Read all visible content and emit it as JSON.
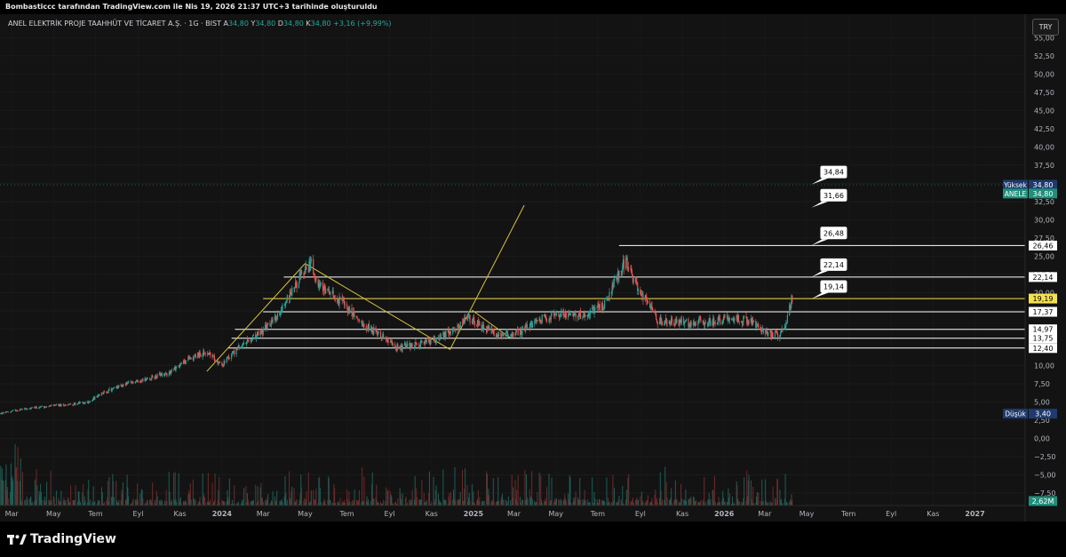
{
  "header": {
    "title": "Bombasticcc tarafından TradingView.com ile Nis 19, 2026 21:37 UTC+3 tarihinde oluşturuldu"
  },
  "legend": {
    "symbol": "ANEL ELEKTRİK PROJE TAAHHÜT VE TİCARET A.Ş. · 1G · BIST",
    "o_label": "A",
    "o_value": "34,80",
    "h_label": "Y",
    "h_value": "34,80",
    "l_label": "D",
    "l_value": "34,80",
    "c_label": "K",
    "c_value": "34,80",
    "change": "+3,16 (+9,99%)"
  },
  "currency": "TRY",
  "brand": "TradingView",
  "colors": {
    "up": "#26a69a",
    "down": "#ef5350",
    "trendline": "#d8c33a",
    "level": "#ffffff",
    "highlight": "#f5e050",
    "high_badge": "#1e3a6e",
    "price_badge": "#1f8f7a"
  },
  "chart_data": {
    "type": "candlestick",
    "ylim": [
      -9.2,
      58.2
    ],
    "xlim": [
      "2023-02-12",
      "2027-03-15"
    ],
    "y_ticks": [
      "55,00",
      "52,50",
      "50,00",
      "47,50",
      "45,00",
      "42,50",
      "40,00",
      "37,50",
      "35,00",
      "32,50",
      "30,00",
      "27,50",
      "25,00",
      "22,50",
      "20,00",
      "17,50",
      "15,00",
      "12,50",
      "10,00",
      "7,50",
      "5,00",
      "2,50",
      "0,00",
      "−2,50",
      "−5,00",
      "−7,50"
    ],
    "x_ticks": [
      {
        "label": "Mar",
        "date": "2023-03-01"
      },
      {
        "label": "May",
        "date": "2023-05-01"
      },
      {
        "label": "Tem",
        "date": "2023-07-01"
      },
      {
        "label": "Eyl",
        "date": "2023-09-01"
      },
      {
        "label": "Kas",
        "date": "2023-11-01"
      },
      {
        "label": "2024",
        "date": "2024-01-01"
      },
      {
        "label": "Mar",
        "date": "2024-03-01"
      },
      {
        "label": "May",
        "date": "2024-05-01"
      },
      {
        "label": "Tem",
        "date": "2024-07-01"
      },
      {
        "label": "Eyl",
        "date": "2024-09-01"
      },
      {
        "label": "Kas",
        "date": "2024-11-01"
      },
      {
        "label": "2025",
        "date": "2025-01-01"
      },
      {
        "label": "Mar",
        "date": "2025-03-01"
      },
      {
        "label": "May",
        "date": "2025-05-01"
      },
      {
        "label": "Tem",
        "date": "2025-07-01"
      },
      {
        "label": "Eyl",
        "date": "2025-09-01"
      },
      {
        "label": "Kas",
        "date": "2025-11-01"
      },
      {
        "label": "2026",
        "date": "2026-01-01"
      },
      {
        "label": "Mar",
        "date": "2026-03-01"
      },
      {
        "label": "May",
        "date": "2026-05-01"
      },
      {
        "label": "Tem",
        "date": "2026-07-01"
      },
      {
        "label": "Eyl",
        "date": "2026-09-01"
      },
      {
        "label": "Kas",
        "date": "2026-11-01"
      },
      {
        "label": "2027",
        "date": "2027-01-01"
      }
    ],
    "price_path": [
      [
        "2023-02-12",
        3.4
      ],
      [
        "2023-03-20",
        4.1
      ],
      [
        "2023-04-20",
        4.4
      ],
      [
        "2023-05-20",
        4.6
      ],
      [
        "2023-06-20",
        5.0
      ],
      [
        "2023-07-15",
        6.4
      ],
      [
        "2023-08-15",
        7.5
      ],
      [
        "2023-09-15",
        8.2
      ],
      [
        "2023-10-15",
        9.0
      ],
      [
        "2023-11-15",
        11.0
      ],
      [
        "2023-12-10",
        11.8
      ],
      [
        "2024-01-01",
        10.0
      ],
      [
        "2024-01-20",
        12.0
      ],
      [
        "2024-02-20",
        14.0
      ],
      [
        "2024-03-20",
        16.5
      ],
      [
        "2024-04-10",
        20.0
      ],
      [
        "2024-04-25",
        22.3
      ],
      [
        "2024-05-10",
        24.0
      ],
      [
        "2024-05-25",
        20.5
      ],
      [
        "2024-06-20",
        19.0
      ],
      [
        "2024-07-20",
        16.0
      ],
      [
        "2024-08-15",
        14.5
      ],
      [
        "2024-09-10",
        12.5
      ],
      [
        "2024-10-10",
        12.8
      ],
      [
        "2024-11-10",
        13.6
      ],
      [
        "2024-12-01",
        14.8
      ],
      [
        "2024-12-25",
        16.5
      ],
      [
        "2025-01-10",
        15.5
      ],
      [
        "2025-02-10",
        14.0
      ],
      [
        "2025-03-10",
        14.6
      ],
      [
        "2025-04-10",
        16.5
      ],
      [
        "2025-05-10",
        17.2
      ],
      [
        "2025-06-10",
        17.0
      ],
      [
        "2025-07-10",
        18.2
      ],
      [
        "2025-07-28",
        22.0
      ],
      [
        "2025-08-10",
        24.5
      ],
      [
        "2025-08-25",
        21.0
      ],
      [
        "2025-09-10",
        18.8
      ],
      [
        "2025-09-25",
        16.2
      ],
      [
        "2025-11-10",
        15.8
      ],
      [
        "2025-12-15",
        16.0
      ],
      [
        "2026-01-10",
        16.6
      ],
      [
        "2026-02-10",
        16.1
      ],
      [
        "2026-03-01",
        14.5
      ],
      [
        "2026-03-20",
        14.2
      ],
      [
        "2026-04-01",
        16.0
      ],
      [
        "2026-04-10",
        19.3
      ]
    ],
    "levels": [
      {
        "value": 26.46,
        "label": "26,46",
        "from": "2025-08-01"
      },
      {
        "value": 22.14,
        "label": "22,14",
        "from": "2024-03-31"
      },
      {
        "value": 19.19,
        "label": "19,19",
        "from": "2024-03-01",
        "highlight": true
      },
      {
        "value": 17.37,
        "label": "17,37",
        "from": "2024-03-01"
      },
      {
        "value": 14.97,
        "label": "14,97",
        "from": "2024-01-20"
      },
      {
        "value": 13.75,
        "label": "13,75",
        "from": "2024-01-15"
      },
      {
        "value": 12.4,
        "label": "12,40",
        "from": "2024-01-10"
      }
    ],
    "trendlines": [
      [
        [
          "2023-12-10",
          9.2
        ],
        [
          "2024-05-01",
          24.0
        ]
      ],
      [
        [
          "2024-05-01",
          24.0
        ],
        [
          "2024-11-28",
          12.2
        ]
      ],
      [
        [
          "2024-11-28",
          12.2
        ],
        [
          "2025-03-16",
          32.0
        ]
      ],
      [
        [
          "2024-12-30",
          17.6
        ],
        [
          "2025-02-25",
          13.7
        ]
      ]
    ],
    "callouts": [
      {
        "label": "34,84",
        "date": "2026-05-08",
        "value": 34.84
      },
      {
        "label": "31,66",
        "date": "2026-05-08",
        "value": 31.66
      },
      {
        "label": "26,48",
        "date": "2026-05-08",
        "value": 26.48
      },
      {
        "label": "22,14",
        "date": "2026-05-08",
        "value": 22.14
      },
      {
        "label": "19,14",
        "date": "2026-05-08",
        "value": 19.14
      }
    ],
    "price_labels": {
      "high": {
        "name": "Yüksek",
        "value": "34,80",
        "y": 34.8
      },
      "symbol": {
        "name": "ANELE",
        "value": "34,80",
        "y": 33.6
      },
      "low": {
        "name": "Düşük",
        "value": "3,40",
        "y": 3.4
      },
      "volume": "2,62M"
    }
  }
}
